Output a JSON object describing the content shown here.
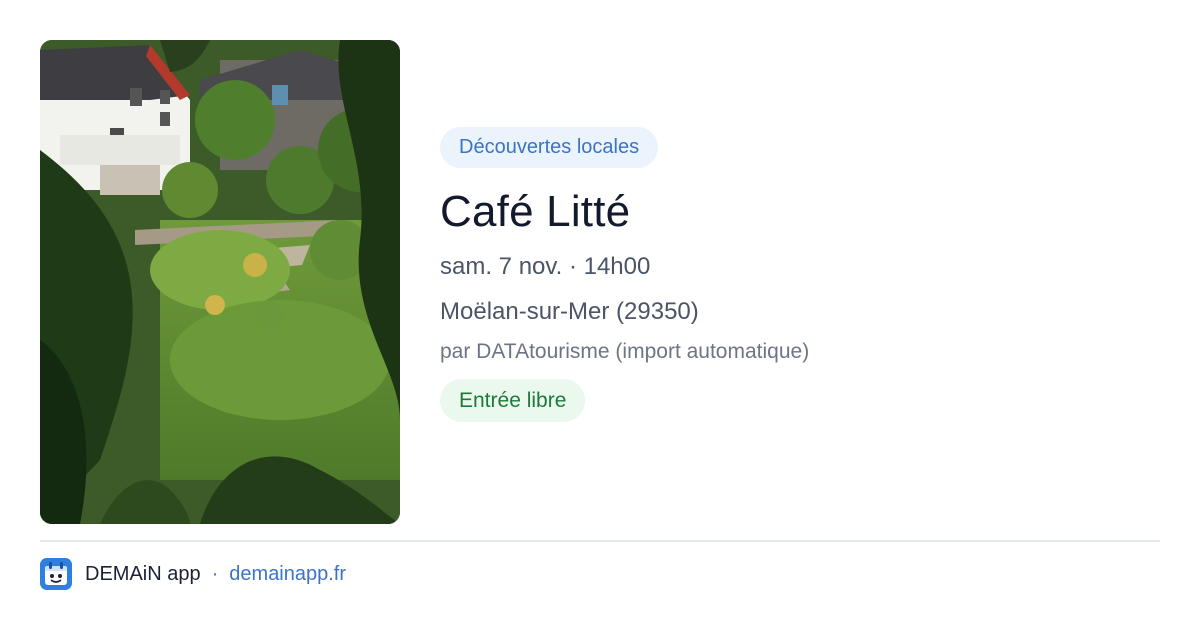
{
  "event": {
    "category": "Découvertes locales",
    "title": "Café Litté",
    "datetime": "sam. 7 nov. · 14h00",
    "location": "Moëlan-sur-Mer (29350)",
    "source": "par DATAtourisme (import automatique)",
    "price": "Entrée libre"
  },
  "footer": {
    "app_name": "DEMAiN app",
    "separator": "·",
    "url": "demainapp.fr"
  },
  "colors": {
    "category_text": "#3b74c6",
    "category_bg": "#ebf3fd",
    "price_text": "#1f7a3a",
    "price_bg": "#eaf8ee",
    "app_icon_bg": "#2f7fe0"
  }
}
